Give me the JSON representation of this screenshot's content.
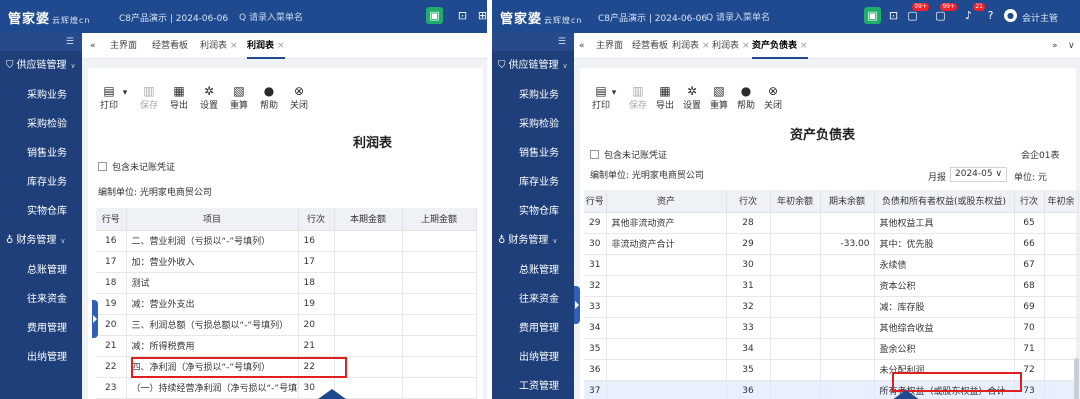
{
  "left": {
    "logo": "管家婆",
    "logo_sub": "云辉煌cn",
    "company": "C8产品演示 | 2024-06-06",
    "search_placeholder": "Q  请录入菜单名",
    "sidebar_top": "☰",
    "sidebar": [
      {
        "type": "group",
        "label": "供应链管理",
        "icon": "⛉"
      },
      {
        "type": "item",
        "label": "采购业务"
      },
      {
        "type": "item",
        "label": "采购检验"
      },
      {
        "type": "item",
        "label": "销售业务"
      },
      {
        "type": "item",
        "label": "库存业务"
      },
      {
        "type": "item",
        "label": "实物仓库"
      },
      {
        "type": "group",
        "label": "财务管理",
        "icon": "♁"
      },
      {
        "type": "item",
        "label": "总账管理"
      },
      {
        "type": "item",
        "label": "往来资金"
      },
      {
        "type": "item",
        "label": "费用管理"
      },
      {
        "type": "item",
        "label": "出纳管理"
      }
    ],
    "tabs": {
      "collapse": "«",
      "home": "主界面",
      "dashboard": "经营看板",
      "profit1": "利润表",
      "profit2": "利润表",
      "close": "×"
    },
    "toolbar": [
      {
        "label": "打印",
        "icon": "▤",
        "disabled": false,
        "dropdown": true
      },
      {
        "label": "保存",
        "icon": "▥",
        "disabled": true
      },
      {
        "label": "导出",
        "icon": "▦",
        "disabled": false
      },
      {
        "label": "设置",
        "icon": "✲",
        "disabled": false
      },
      {
        "label": "重算",
        "icon": "▧",
        "disabled": false
      },
      {
        "label": "帮助",
        "icon": "●",
        "disabled": false
      },
      {
        "label": "关闭",
        "icon": "⊗",
        "disabled": false
      }
    ],
    "title": "利润表",
    "include_unposted": "包含未记账凭证",
    "unit": "编制单位:  光明家电商贸公司",
    "columns": [
      "行号",
      "项目",
      "行次",
      "本期金额",
      "上期金额"
    ],
    "rows": [
      [
        "16",
        "二、营业利润（亏损以“-”号填列）",
        "16",
        "",
        ""
      ],
      [
        "17",
        "加：营业外收入",
        "17",
        "",
        ""
      ],
      [
        "18",
        "测试",
        "18",
        "",
        ""
      ],
      [
        "19",
        "减：营业外支出",
        "19",
        "",
        ""
      ],
      [
        "20",
        "三、利润总额（亏损总额以“-”号填列）",
        "20",
        "",
        ""
      ],
      [
        "21",
        "减：所得税费用",
        "21",
        "",
        ""
      ],
      [
        "22",
        "四、净利润（净亏损以“-”号填列）",
        "22",
        "",
        ""
      ],
      [
        "23",
        "（一）持续经营净利润（净亏损以“-”号填列）",
        "30",
        "",
        ""
      ]
    ]
  },
  "right": {
    "logo": "管家婆",
    "logo_sub": "云辉煌cn",
    "company": "C8产品演示 | 2024-06-06",
    "search_placeholder": "Q  请录入菜单名",
    "badge1": "99+",
    "badge2": "99+",
    "badge3": "21",
    "user": "会计主管",
    "sidebar_top": "☰",
    "sidebar": [
      {
        "type": "group",
        "label": "供应链管理",
        "icon": "⛉"
      },
      {
        "type": "item",
        "label": "采购业务"
      },
      {
        "type": "item",
        "label": "采购检验"
      },
      {
        "type": "item",
        "label": "销售业务"
      },
      {
        "type": "item",
        "label": "库存业务"
      },
      {
        "type": "item",
        "label": "实物仓库"
      },
      {
        "type": "group",
        "label": "财务管理",
        "icon": "♁"
      },
      {
        "type": "item",
        "label": "总账管理"
      },
      {
        "type": "item",
        "label": "往来资金"
      },
      {
        "type": "item",
        "label": "费用管理"
      },
      {
        "type": "item",
        "label": "出纳管理"
      },
      {
        "type": "item",
        "label": "工资管理"
      }
    ],
    "tabs": {
      "collapse": "«",
      "home": "主界面",
      "dashboard": "经营看板",
      "profit": "利润表",
      "profit2": "利润表",
      "bs": "资产负债表",
      "close": "×",
      "more": "»",
      "down": "∨"
    },
    "toolbar": [
      {
        "label": "打印",
        "icon": "▤",
        "disabled": false,
        "dropdown": true
      },
      {
        "label": "保存",
        "icon": "▥",
        "disabled": true
      },
      {
        "label": "导出",
        "icon": "▦",
        "disabled": false
      },
      {
        "label": "设置",
        "icon": "✲",
        "disabled": false
      },
      {
        "label": "重算",
        "icon": "▧",
        "disabled": false
      },
      {
        "label": "帮助",
        "icon": "●",
        "disabled": false
      },
      {
        "label": "关闭",
        "icon": "⊗",
        "disabled": false
      }
    ],
    "title": "资产负债表",
    "include_unposted": "包含未记账凭证",
    "form_code": "会企01表",
    "unit": "编制单位:  光明家电商贸公司",
    "period_label": "月报",
    "period_value": "2024-05",
    "currency": "单位: 元",
    "columns": [
      "行号",
      "资产",
      "行次",
      "年初余额",
      "期末余额",
      "负债和所有者权益(或股东权益)",
      "行次",
      "年初余"
    ],
    "rows": [
      [
        "29",
        "其他非流动资产",
        "28",
        "",
        "",
        "其他权益工具",
        "65"
      ],
      [
        "30",
        "非流动资产合计",
        "29",
        "",
        "-33.00",
        "其中：优先股",
        "66"
      ],
      [
        "31",
        "",
        "30",
        "",
        "",
        "永续债",
        "67"
      ],
      [
        "32",
        "",
        "31",
        "",
        "",
        "资本公积",
        "68"
      ],
      [
        "33",
        "",
        "32",
        "",
        "",
        "减：库存股",
        "69"
      ],
      [
        "34",
        "",
        "33",
        "",
        "",
        "其他综合收益",
        "70"
      ],
      [
        "35",
        "",
        "34",
        "",
        "",
        "盈余公积",
        "71"
      ],
      [
        "36",
        "",
        "35",
        "",
        "",
        "未分配利润",
        "72"
      ],
      [
        "37",
        "",
        "36",
        "",
        "",
        "所有者权益（或股东权益）合计",
        "73"
      ]
    ]
  }
}
